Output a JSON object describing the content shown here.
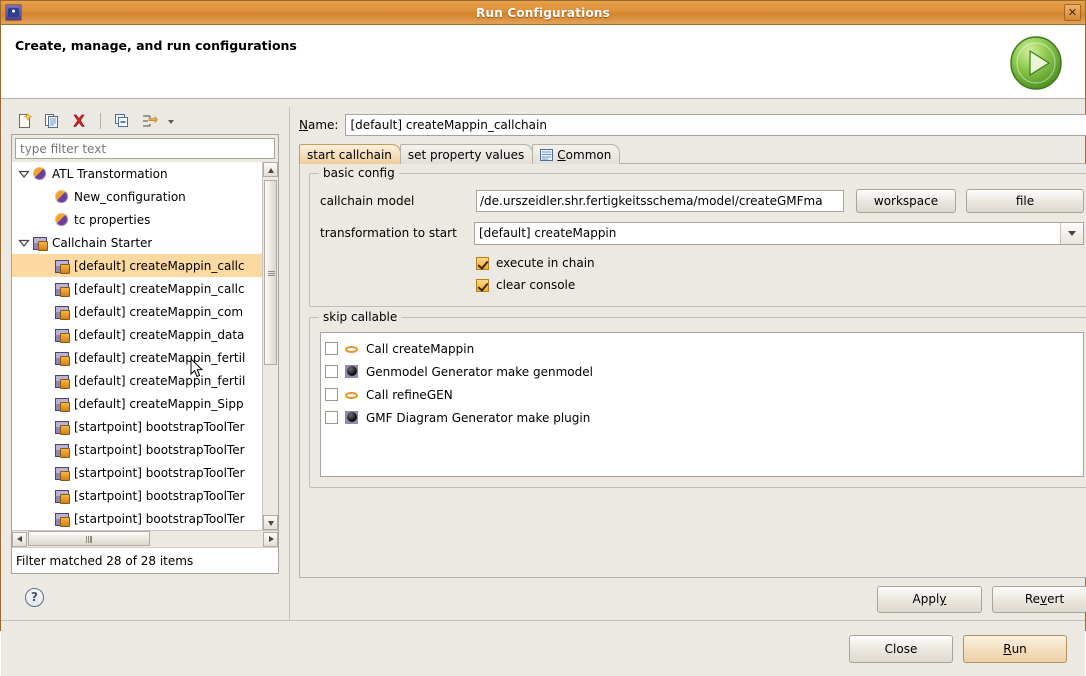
{
  "window": {
    "title": "Run Configurations",
    "app_icon": "eclipse-icon",
    "close_label": "✕"
  },
  "header": {
    "title": "Create, manage, and run configurations",
    "hero_icon": "run-green-play-icon"
  },
  "left_toolbar": {
    "items": [
      {
        "name": "new-configuration-icon",
        "tooltip": "New launch configuration"
      },
      {
        "name": "duplicate-configuration-icon",
        "tooltip": "Duplicate"
      },
      {
        "name": "delete-configuration-icon",
        "tooltip": "Delete"
      },
      {
        "name": "collapse-all-icon",
        "tooltip": "Collapse All"
      },
      {
        "name": "filter-icon",
        "tooltip": "Filter"
      }
    ]
  },
  "filter": {
    "placeholder": "type filter text",
    "value": "",
    "status": "Filter matched 28 of 28 items"
  },
  "tree": {
    "items": [
      {
        "label": "ATL Transtormation",
        "icon": "atl-icon",
        "level": 0,
        "twisty": "open",
        "selected": false
      },
      {
        "label": "New_configuration",
        "icon": "atl-icon",
        "level": 1,
        "twisty": "none",
        "selected": false
      },
      {
        "label": "tc properties",
        "icon": "atl-icon",
        "level": 1,
        "twisty": "none",
        "selected": false
      },
      {
        "label": "Callchain Starter",
        "icon": "callchain-icon",
        "level": 0,
        "twisty": "open",
        "selected": false
      },
      {
        "label": "[default] createMappin_callc",
        "icon": "callchain-icon",
        "level": 1,
        "twisty": "none",
        "selected": true
      },
      {
        "label": "[default] createMappin_callc",
        "icon": "callchain-icon",
        "level": 1,
        "twisty": "none",
        "selected": false
      },
      {
        "label": "[default] createMappin_com",
        "icon": "callchain-icon",
        "level": 1,
        "twisty": "none",
        "selected": false
      },
      {
        "label": "[default] createMappin_data",
        "icon": "callchain-icon",
        "level": 1,
        "twisty": "none",
        "selected": false
      },
      {
        "label": "[default] createMappin_fertil",
        "icon": "callchain-icon",
        "level": 1,
        "twisty": "none",
        "selected": false
      },
      {
        "label": "[default] createMappin_fertil",
        "icon": "callchain-icon",
        "level": 1,
        "twisty": "none",
        "selected": false
      },
      {
        "label": "[default] createMappin_Sipp",
        "icon": "callchain-icon",
        "level": 1,
        "twisty": "none",
        "selected": false
      },
      {
        "label": "[startpoint] bootstrapToolTer",
        "icon": "callchain-icon",
        "level": 1,
        "twisty": "none",
        "selected": false
      },
      {
        "label": "[startpoint] bootstrapToolTer",
        "icon": "callchain-icon",
        "level": 1,
        "twisty": "none",
        "selected": false
      },
      {
        "label": "[startpoint] bootstrapToolTer",
        "icon": "callchain-icon",
        "level": 1,
        "twisty": "none",
        "selected": false
      },
      {
        "label": "[startpoint] bootstrapToolTer",
        "icon": "callchain-icon",
        "level": 1,
        "twisty": "none",
        "selected": false
      },
      {
        "label": "[startpoint] bootstrapToolTer",
        "icon": "callchain-icon",
        "level": 1,
        "twisty": "none",
        "selected": false
      }
    ]
  },
  "help": {
    "label": "?"
  },
  "name_field": {
    "label_prefix": "N",
    "label_rest": "ame:",
    "value": "[default] createMappin_callchain"
  },
  "tabs": [
    {
      "label": "start callchain",
      "icon": "none",
      "active": true
    },
    {
      "label": "set property values",
      "icon": "none",
      "active": false
    },
    {
      "label": "Common",
      "icon": "common-tab-icon",
      "active": false,
      "mnemonic": "C",
      "rest": "ommon"
    }
  ],
  "basic_config": {
    "legend": "basic config",
    "callchain_model_label": "callchain model",
    "callchain_model_value": "/de.urszeidler.shr.fertigkeitsschema/model/createGMFma",
    "workspace_button": "workspace",
    "file_button": "file",
    "transformation_label": "transformation to start",
    "transformation_value": "[default] createMappin",
    "checkboxes": [
      {
        "label": "execute in chain",
        "checked": true
      },
      {
        "label": "clear console",
        "checked": true
      }
    ]
  },
  "skip_callable": {
    "legend": "skip callable",
    "rows": [
      {
        "label": "Call createMappin",
        "icon": "call-icon",
        "checked": false
      },
      {
        "label": "Genmodel Generator make genmodel",
        "icon": "generator-icon",
        "checked": false
      },
      {
        "label": "Call refineGEN",
        "icon": "call-icon",
        "checked": false
      },
      {
        "label": "GMF Diagram Generator make plugin",
        "icon": "generator-icon",
        "checked": false
      }
    ]
  },
  "form_buttons": {
    "apply": {
      "pre": "Appl",
      "mnemonic": "y",
      "post": ""
    },
    "revert": {
      "pre": "Re",
      "mnemonic": "v",
      "post": "ert"
    }
  },
  "dialog_buttons": {
    "close": "Close",
    "run": {
      "mnemonic": "R",
      "rest": "un"
    }
  },
  "colors": {
    "titlebar_accent": "#dd9038",
    "selection": "#fcd9a0",
    "active_tab": "#f0cd9b",
    "checkbox_checked": "#f2ab2e",
    "background": "#ece9e2"
  }
}
